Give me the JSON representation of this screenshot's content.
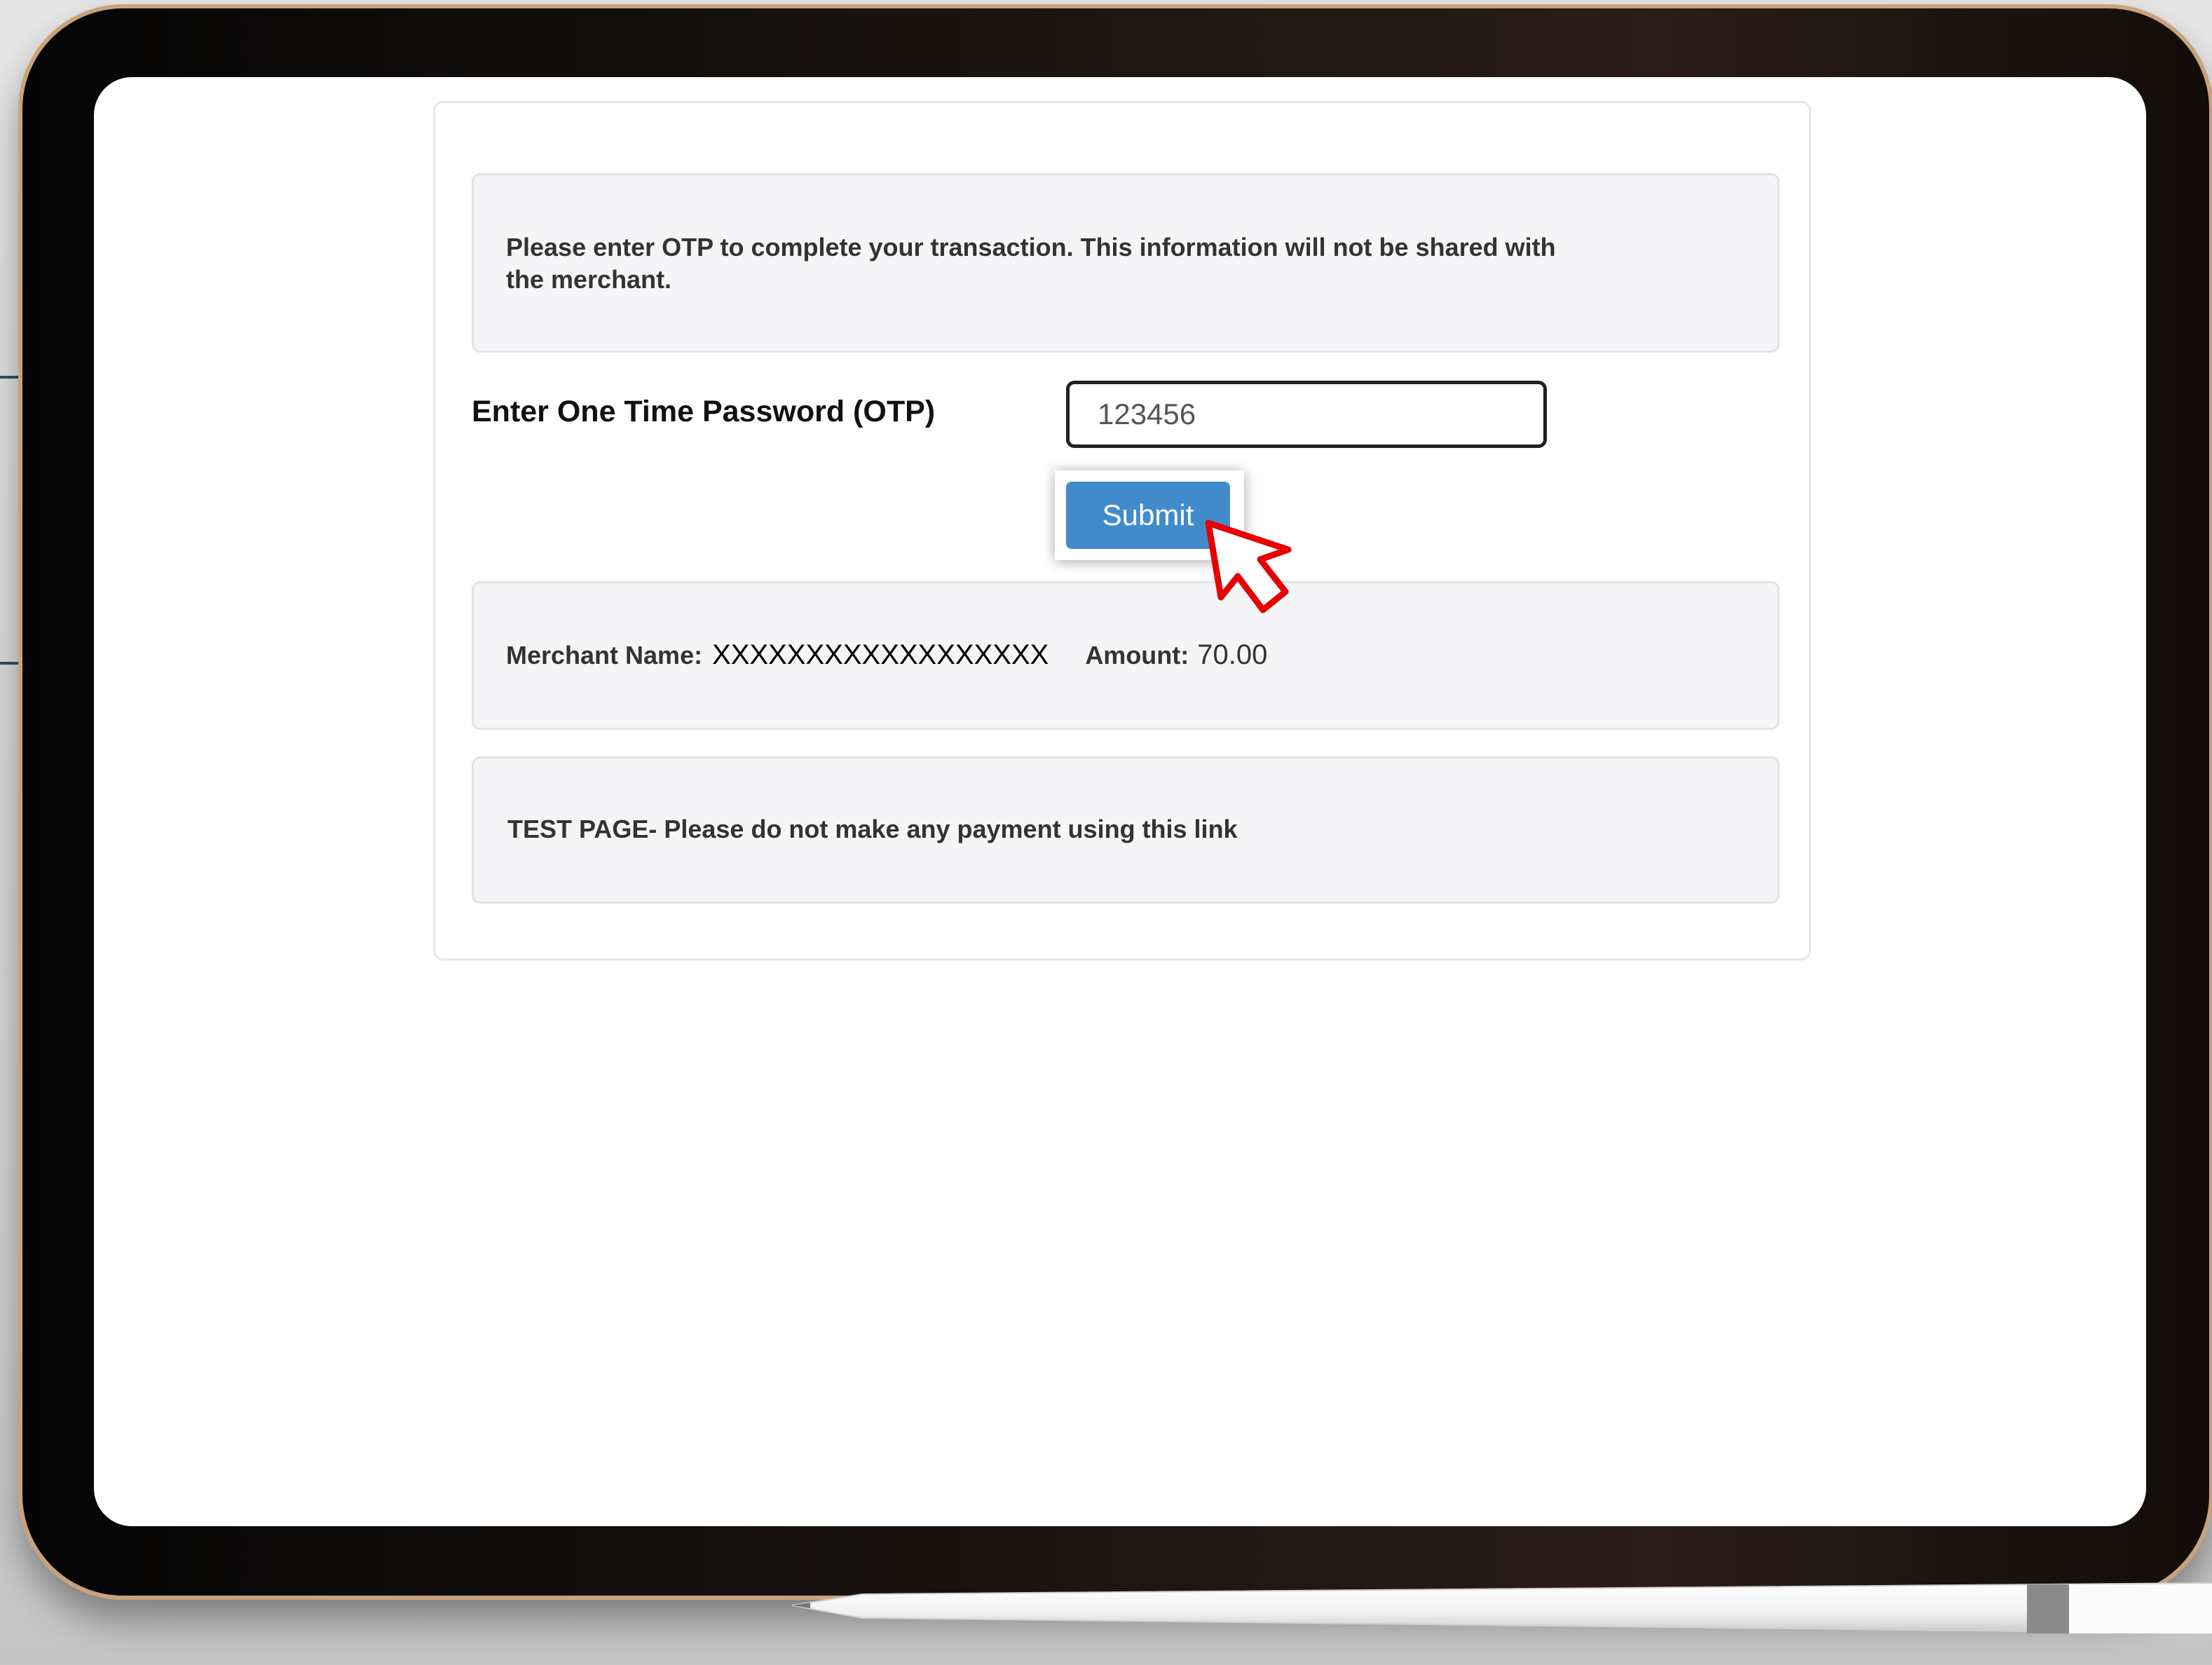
{
  "otp_page": {
    "notice": "Please enter OTP to complete your transaction. This information will not be shared with the merchant.",
    "otp_label": "Enter One Time Password (OTP)",
    "otp_value": "123456",
    "submit_label": "Submit",
    "merchant_label": "Merchant Name:",
    "merchant_value": "XXXXXXXXXXXXXXXXXX",
    "amount_label": "Amount:",
    "amount_value": "70.00",
    "test_notice": "TEST PAGE- Please do not make any payment using this link"
  },
  "colors": {
    "submit_button": "#428bca",
    "cursor_annotation": "#e60000",
    "panel_background": "#f5f5f7"
  },
  "icons": {
    "cursor": "red-pointer-cursor-icon"
  }
}
